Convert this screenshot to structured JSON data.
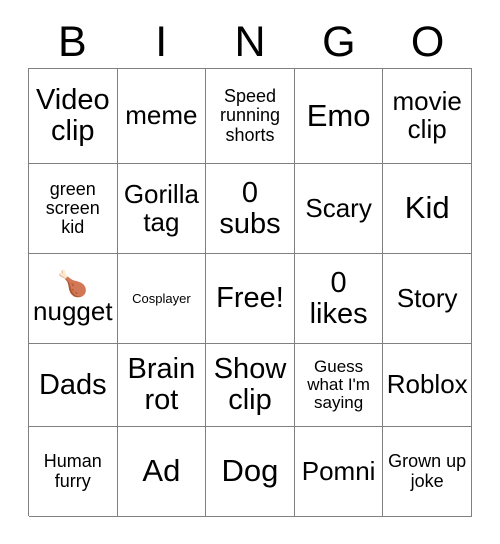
{
  "title": "BINGO Card",
  "header": {
    "letters": [
      "B",
      "I",
      "N",
      "G",
      "O"
    ]
  },
  "colors": {
    "background": "#ffffff",
    "text": "#000000",
    "grid_line": "#808080"
  },
  "grid": {
    "columns": 5,
    "rows": 5,
    "free_space": {
      "row": 3,
      "column": 3,
      "label": "Free!"
    },
    "cells": [
      [
        {
          "text": "Video clip",
          "size": "lg"
        },
        {
          "text": "meme",
          "size": "md"
        },
        {
          "text": "Speed running shorts",
          "size": "sm"
        },
        {
          "text": "Emo",
          "size": "xl"
        },
        {
          "text": "movie clip",
          "size": "md"
        }
      ],
      [
        {
          "text": "green screen kid",
          "size": "sm"
        },
        {
          "text": "Gorilla tag",
          "size": "md"
        },
        {
          "text": "0 subs",
          "size": "lg"
        },
        {
          "text": "Scary",
          "size": "md"
        },
        {
          "text": "Kid",
          "size": "xl"
        }
      ],
      [
        {
          "text": "nugget",
          "size": "md",
          "emoji": "poultry-leg"
        },
        {
          "text": "Cosplayer",
          "size": "tiny"
        },
        {
          "text": "Free!",
          "size": "lg"
        },
        {
          "text": "0 likes",
          "size": "lg"
        },
        {
          "text": "Story",
          "size": "md"
        }
      ],
      [
        {
          "text": "Dads",
          "size": "lg"
        },
        {
          "text": "Brain rot",
          "size": "lg"
        },
        {
          "text": "Show clip",
          "size": "lg"
        },
        {
          "text": "Guess what I'm saying",
          "size": "xs"
        },
        {
          "text": "Roblox",
          "size": "md"
        }
      ],
      [
        {
          "text": "Human furry",
          "size": "sm"
        },
        {
          "text": "Ad",
          "size": "xl"
        },
        {
          "text": "Dog",
          "size": "xl"
        },
        {
          "text": "Pomni",
          "size": "md"
        },
        {
          "text": "Grown up joke",
          "size": "sm"
        }
      ]
    ]
  }
}
